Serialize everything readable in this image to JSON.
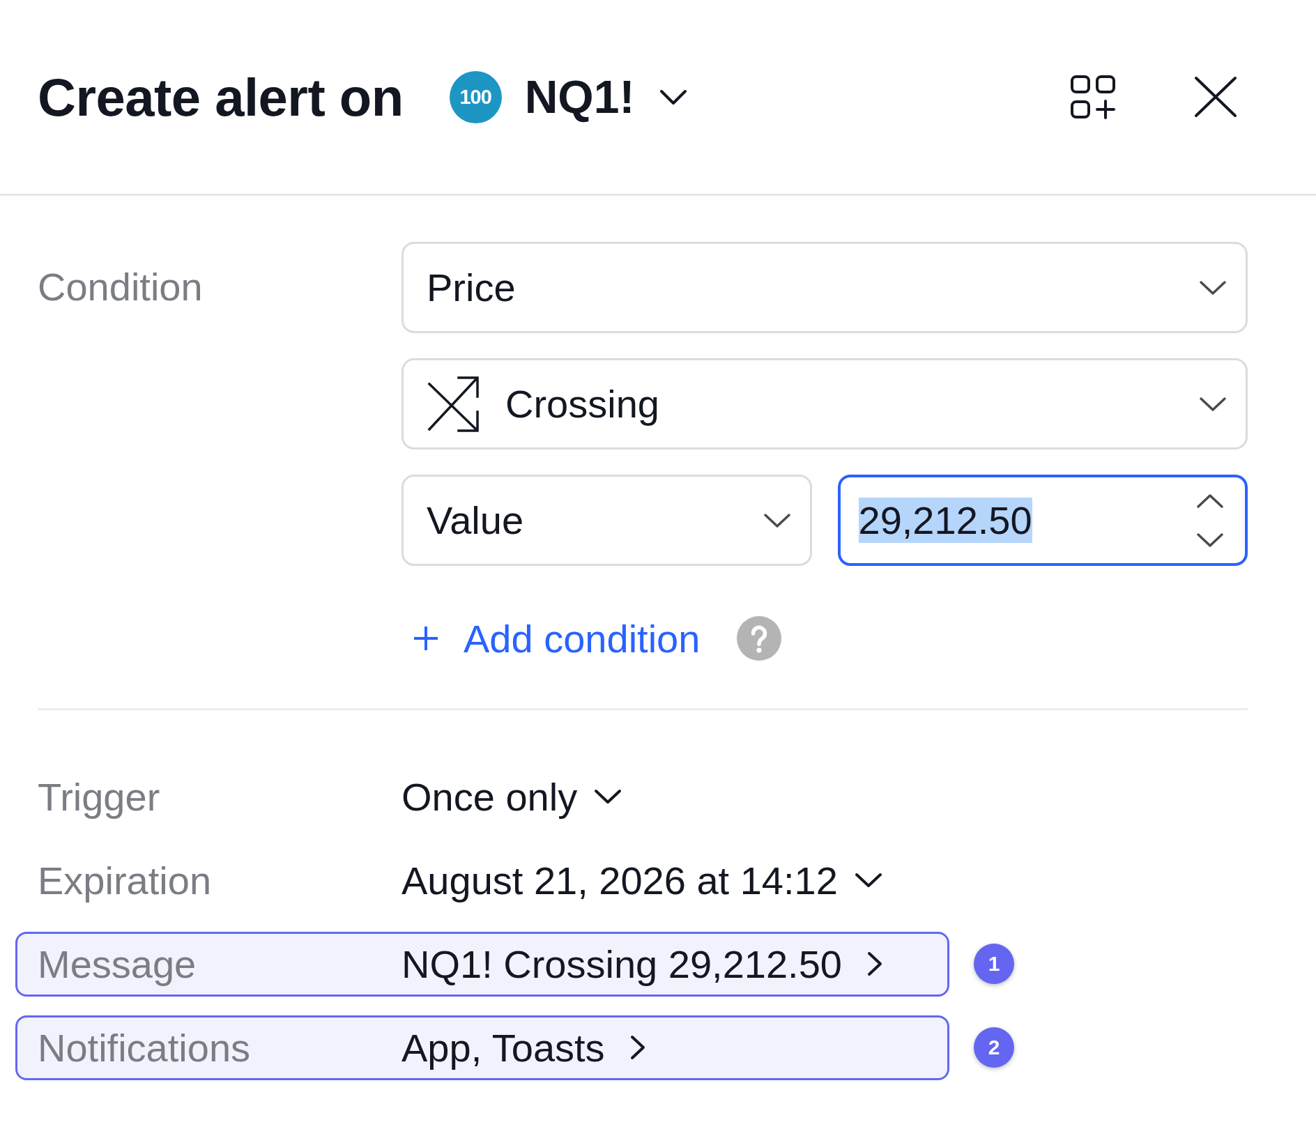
{
  "header": {
    "title": "Create alert on",
    "symbol_badge": "100",
    "symbol": "NQ1!"
  },
  "condition": {
    "label": "Condition",
    "source": "Price",
    "operator": "Crossing",
    "operand_type": "Value",
    "value": "29,212.50",
    "focused": true,
    "text_selected": true,
    "add_label": "Add condition"
  },
  "settings": [
    {
      "label": "Trigger",
      "value": "Once only",
      "kind": "dropdown",
      "highlighted": false
    },
    {
      "label": "Expiration",
      "value": "August 21, 2026 at 14:12",
      "kind": "dropdown",
      "highlighted": false
    },
    {
      "label": "Message",
      "value": "NQ1! Crossing 29,212.50",
      "kind": "link",
      "highlighted": true,
      "marker": "1"
    },
    {
      "label": "Notifications",
      "value": "App, Toasts",
      "kind": "link",
      "highlighted": true,
      "marker": "2"
    }
  ]
}
